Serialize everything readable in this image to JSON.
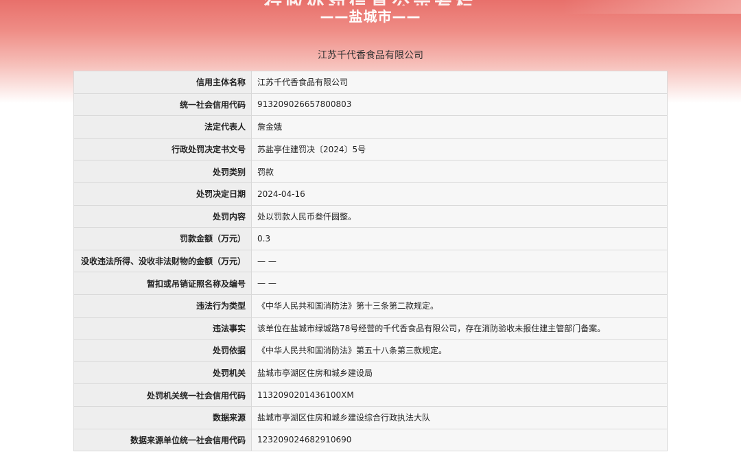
{
  "header": {
    "banner_fragment": "行政处罚信息公示专栏",
    "region_subtitle": "——盐城市——",
    "company_title": "江苏千代香食品有限公司"
  },
  "rows": [
    {
      "label": "信用主体名称",
      "value": "江苏千代香食品有限公司"
    },
    {
      "label": "统一社会信用代码",
      "value": "913209026657800803"
    },
    {
      "label": "法定代表人",
      "value": "詹金娥"
    },
    {
      "label": "行政处罚决定书文号",
      "value": "苏盐亭住建罚决〔2024〕5号"
    },
    {
      "label": "处罚类别",
      "value": "罚款"
    },
    {
      "label": "处罚决定日期",
      "value": "2024-04-16"
    },
    {
      "label": "处罚内容",
      "value": "处以罚款人民币叁仟圆整。"
    },
    {
      "label": "罚款金额（万元）",
      "value": "0.3"
    },
    {
      "label": "没收违法所得、没收非法财物的金额（万元）",
      "value": "— —"
    },
    {
      "label": "暂扣或吊销证照名称及编号",
      "value": "— —"
    },
    {
      "label": "违法行为类型",
      "value": "《中华人民共和国消防法》第十三条第二款规定。"
    },
    {
      "label": "违法事实",
      "value": "该单位在盐城市绿城路78号经营的千代香食品有限公司，存在消防验收未报住建主管部门备案。"
    },
    {
      "label": "处罚依据",
      "value": "《中华人民共和国消防法》第五十八条第三款规定。"
    },
    {
      "label": "处罚机关",
      "value": "盐城市亭湖区住房和城乡建设局"
    },
    {
      "label": "处罚机关统一社会信用代码",
      "value": "1132090201436100XM"
    },
    {
      "label": "数据来源",
      "value": "盐城市亭湖区住房和城乡建设综合行政执法大队"
    },
    {
      "label": "数据来源单位统一社会信用代码",
      "value": "123209024682910690"
    }
  ]
}
